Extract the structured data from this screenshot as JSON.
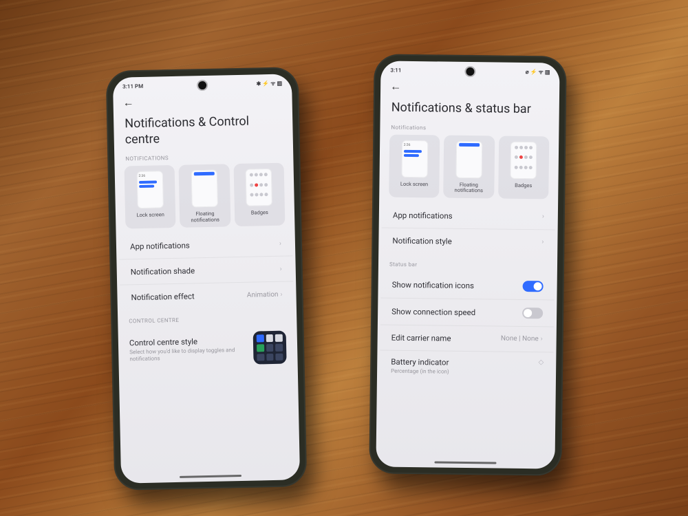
{
  "left": {
    "status": {
      "time": "3:11 PM",
      "icons": "✱  ⚡ ᯤ ▥"
    },
    "title": "Notifications & Control centre",
    "section_notifications": "NOTIFICATIONS",
    "cards": {
      "lock": {
        "label": "Lock screen",
        "time": "2:36"
      },
      "floating": {
        "label": "Floating\nnotifications"
      },
      "badges": {
        "label": "Badges"
      }
    },
    "rows": {
      "app": "App notifications",
      "shade": "Notification shade",
      "effect": {
        "label": "Notification effect",
        "value": "Animation"
      }
    },
    "section_cc": "CONTROL CENTRE",
    "cc": {
      "title": "Control centre style",
      "sub": "Select how you'd like to display toggles and notifications"
    }
  },
  "right": {
    "status": {
      "time": "3:11",
      "icons": "⌀ ⚡ ᯤ ▥"
    },
    "title": "Notifications & status bar",
    "section_notifications": "Notifications",
    "cards": {
      "lock": {
        "label": "Lock screen",
        "time": "2:36"
      },
      "floating": {
        "label": "Floating\nnotifications"
      },
      "badges": {
        "label": "Badges"
      }
    },
    "rows": {
      "app": "App notifications",
      "style": "Notification style"
    },
    "section_statusbar": "Status bar",
    "status_rows": {
      "show_icons": {
        "label": "Show notification icons",
        "on": true
      },
      "show_speed": {
        "label": "Show connection speed",
        "on": false
      },
      "carrier": {
        "label": "Edit carrier name",
        "value": "None | None"
      },
      "battery": {
        "label": "Battery indicator",
        "sub": "Percentage (in the icon)"
      }
    }
  }
}
